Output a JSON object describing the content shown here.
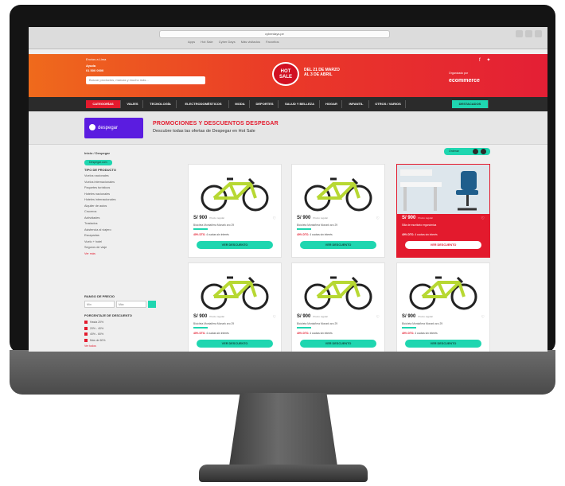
{
  "browser": {
    "url": "cyberdays.pe",
    "bookmarks": [
      "Apps",
      "Hot Sale",
      "Cyber Days",
      "Más visitados",
      "Favoritos"
    ]
  },
  "header": {
    "deliver_to": "Envíos a Lima",
    "help_title": "Ayuda",
    "help_phone": "01 500 0000",
    "search_placeholder": "Buscar productos, marcas y mucho más...",
    "logo_line1": "HOT",
    "logo_line2": "SALE",
    "date_line1": "DEL 21 DE MARZO",
    "date_line2": "AL 3 DE ABRIL",
    "social_icons": [
      "facebook-icon",
      "twitter-icon"
    ],
    "partner_label": "Organizado por",
    "partner_logo": "ecommerce"
  },
  "nav": {
    "items": [
      "CATEGORÍAS",
      "VIAJES",
      "TECNOLOGÍA",
      "ELECTRODOMÉSTICOS",
      "MODA",
      "DEPORTES",
      "SALUD Y BELLEZA",
      "HOGAR",
      "INFANTIL",
      "OTROS / VARIOS",
      "DESTACADOS"
    ]
  },
  "promo": {
    "brand": "despegar",
    "title": "PROMOCIONES Y DESCUENTOS DESPEGAR",
    "subtitle": "Descubre todas las ofertas de Despegar en Hot Sale"
  },
  "sidebar": {
    "breadcrumb": "Inicio / Despegar",
    "active_filter": "Despegar.com",
    "category_heading": "TIPO DE PRODUCTO",
    "categories": [
      "Vuelos nacionales",
      "Vuelos internacionales",
      "Paquetes turísticos",
      "Hoteles nacionales",
      "Hoteles internacionales",
      "Alquiler de autos",
      "Cruceros",
      "Actividades",
      "Traslados",
      "Asistencia al viajero",
      "Escapadas",
      "Vuelo + hotel",
      "Seguros de viaje",
      "Ver más"
    ],
    "price_heading": "RANGO DE PRECIO",
    "price_min": "Mín",
    "price_max": "Máx",
    "shipping_heading": "PORCENTAJE DE DESCUENTO",
    "shipping": [
      "Hasta 20%",
      "20% - 40%",
      "40% - 60%",
      "Más de 60%",
      "Ver todos"
    ]
  },
  "results": {
    "sort_label": "Ordenar"
  },
  "products": [
    {
      "price": "S/ 900",
      "price_note": "Precio regular",
      "name": "Bicicleta Montañera Monark aro 29",
      "discount": "40% DTO.",
      "discount_note": "4 cuotas sin interés",
      "cta": "VER DESCUENTO"
    },
    {
      "price": "S/ 900",
      "price_note": "Precio regular",
      "name": "Bicicleta Montañera Monark aro 29",
      "discount": "40% DTO.",
      "discount_note": "4 cuotas sin interés",
      "cta": "VER DESCUENTO"
    },
    {
      "price": "S/ 900",
      "price_note": "Precio regular",
      "name": "Silla de escritorio ergonómica",
      "discount": "40% DTO.",
      "discount_note": "4 cuotas sin interés",
      "cta": "VER DESCUENTO"
    },
    {
      "price": "S/ 900",
      "price_note": "Precio regular",
      "name": "Bicicleta Montañera Monark aro 29",
      "discount": "40% DTO.",
      "discount_note": "4 cuotas sin interés",
      "cta": "VER DESCUENTO"
    },
    {
      "price": "S/ 900",
      "price_note": "Precio regular",
      "name": "Bicicleta Montañera Monark aro 29",
      "discount": "40% DTO.",
      "discount_note": "4 cuotas sin interés",
      "cta": "VER DESCUENTO"
    },
    {
      "price": "S/ 900",
      "price_note": "Precio regular",
      "name": "Bicicleta Montañera Monark aro 29",
      "discount": "40% DTO.",
      "discount_note": "4 cuotas sin interés",
      "cta": "VER DESCUENTO"
    }
  ],
  "colors": {
    "brand_red": "#e31a2d",
    "accent_teal": "#1fd6b0",
    "nav_dark": "#2b2b2b",
    "promo_purple": "#5b1ce0"
  }
}
